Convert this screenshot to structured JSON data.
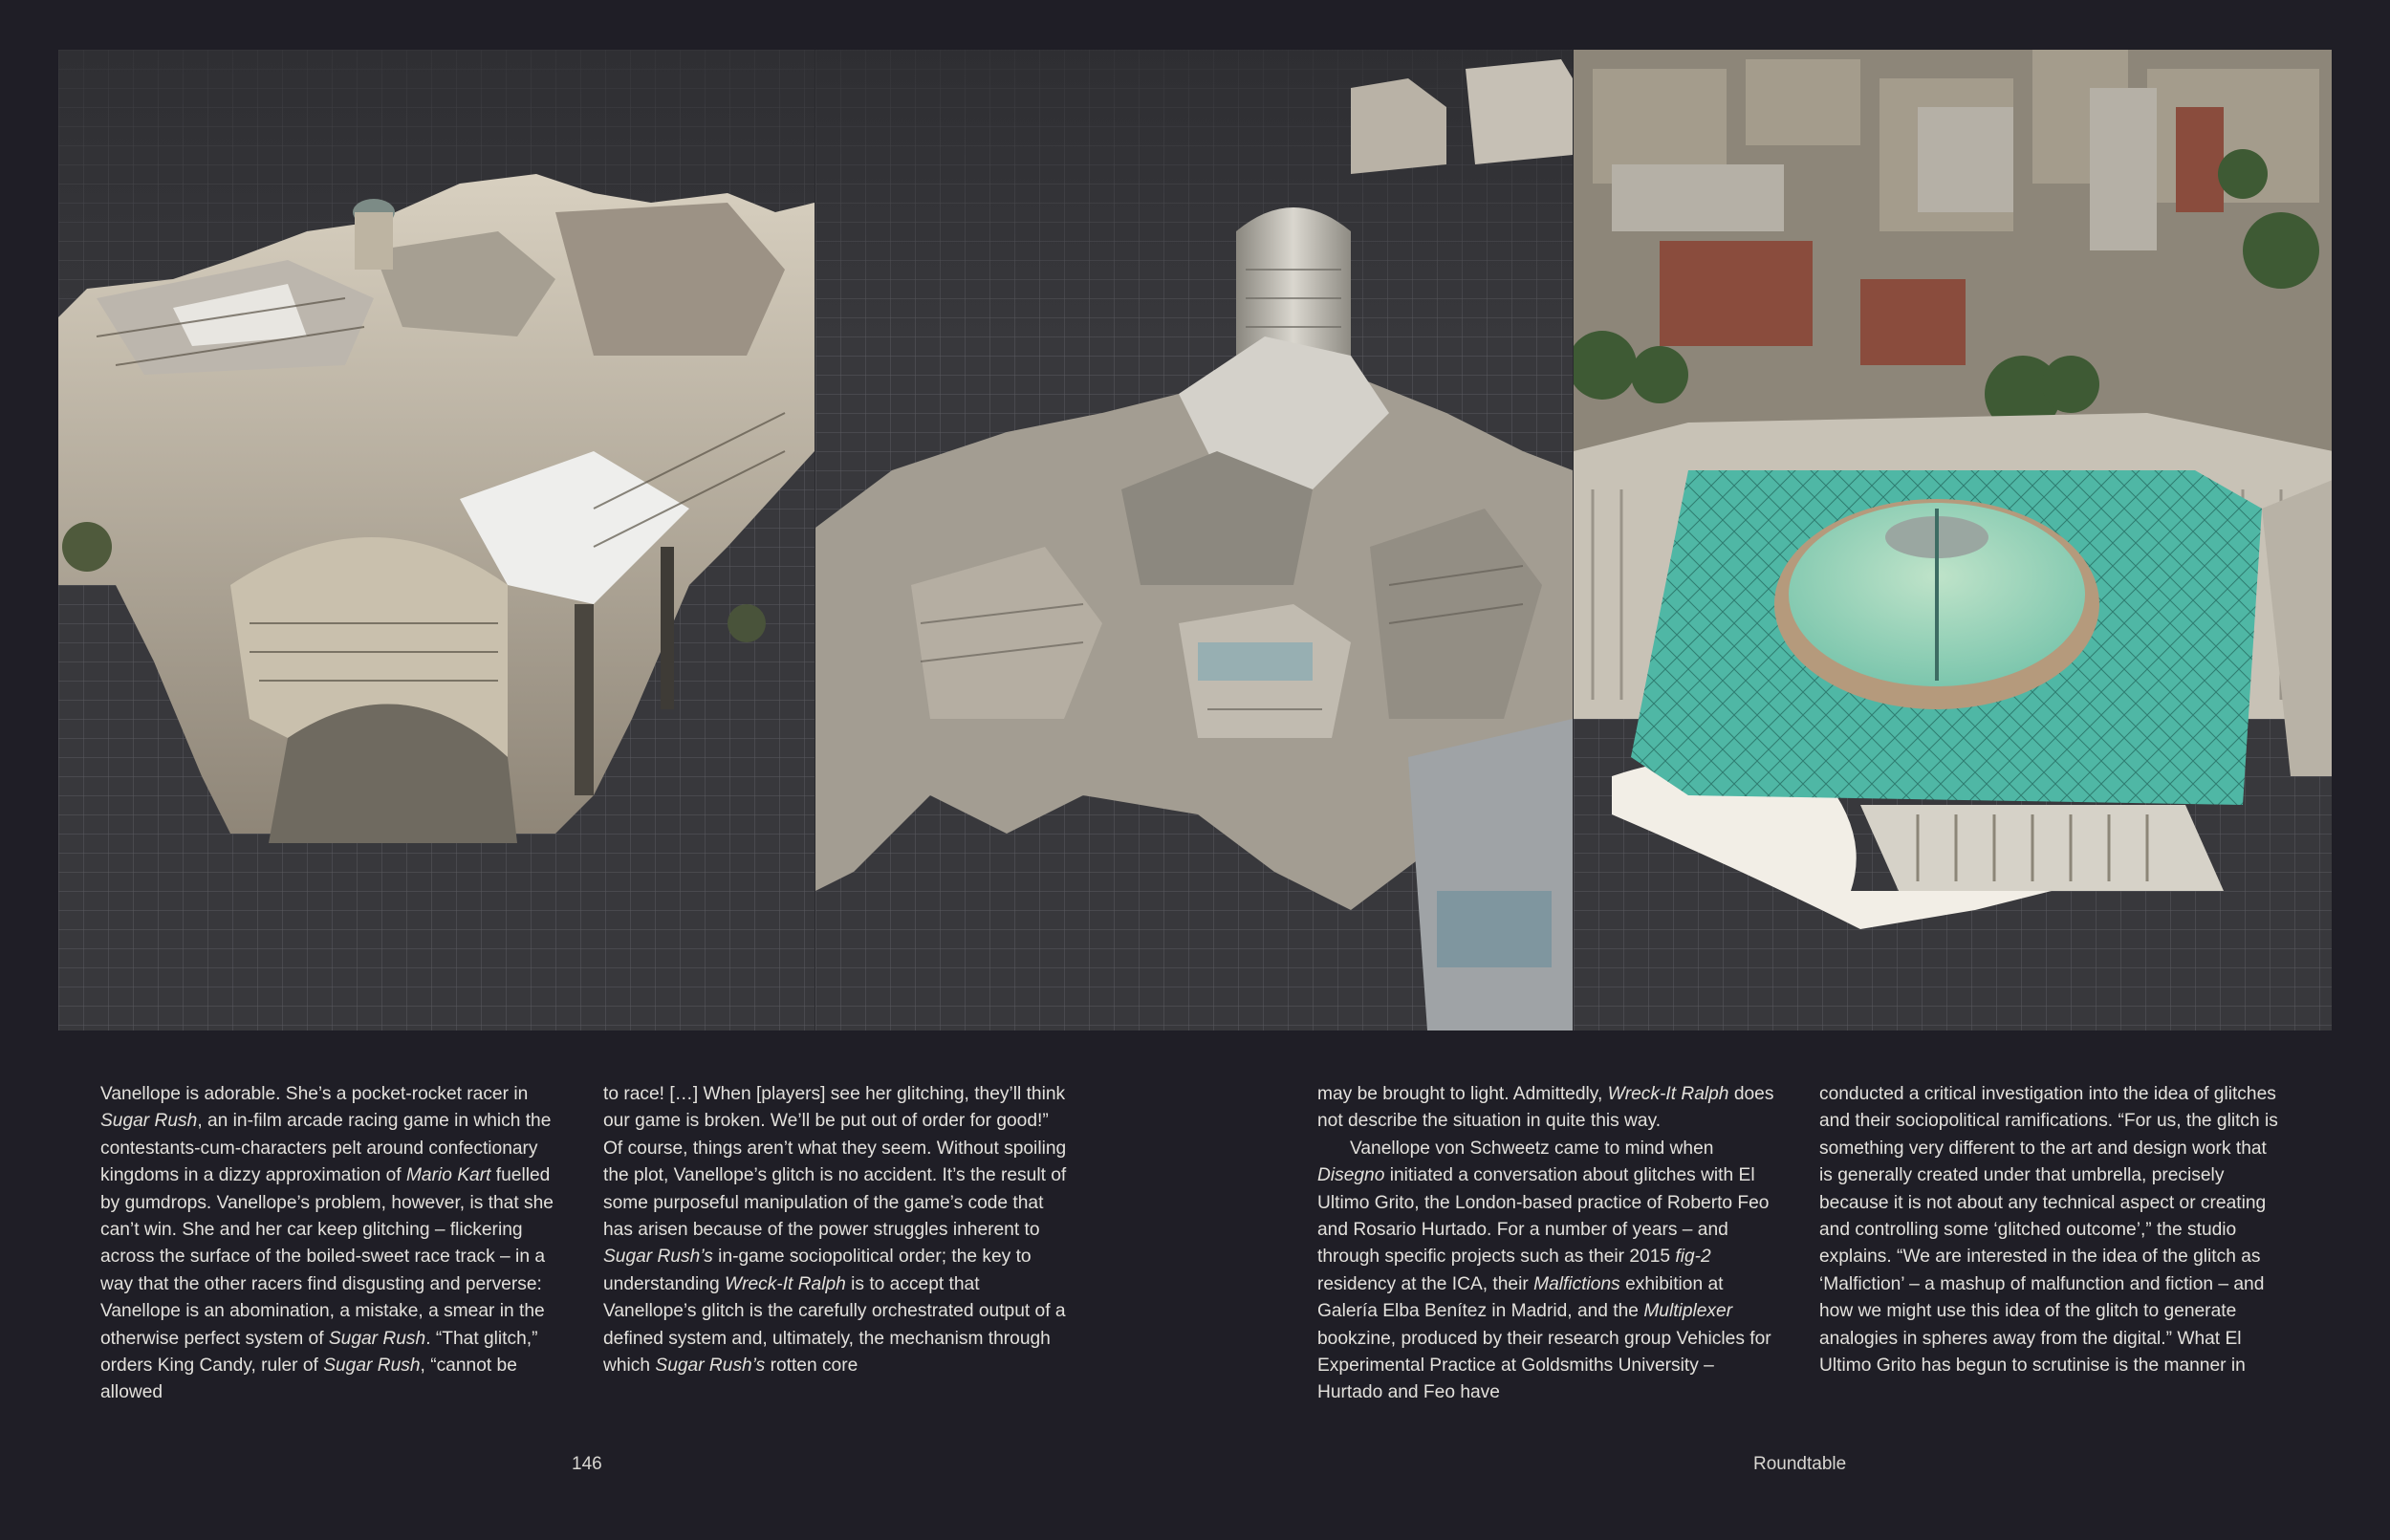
{
  "figure": {
    "panels": [
      {
        "subject": "aerial-3d-city-model-somerset-house"
      },
      {
        "subject": "aerial-3d-city-model-office-towers"
      },
      {
        "subject": "aerial-3d-city-model-british-museum-great-court"
      }
    ],
    "colors": {
      "grid_floor": "#3a3a3e",
      "grid_line": "#5b5b60",
      "glass_roof": "#4fb7a5",
      "stone": "#cfc6b4"
    }
  },
  "columns": {
    "c1": {
      "s1": "Vanellope is adorable. She’s a pocket-rocket racer in ",
      "i1": "Sugar Rush",
      "s2": ", an in-film arcade racing game in which the contestants-cum-characters pelt around confectionary kingdoms in a dizzy approximation of ",
      "i2": "Mario Kart",
      "s3": " fuelled by gumdrops. Vanellope’s problem, however, is that she can’t win. She and her car keep glitching – flickering across the surface of the boiled-sweet race track – in a way that the other racers find disgusting and perverse: Vanellope is an abomination, a mistake, a smear in the otherwise perfect system of ",
      "i3": "Sugar Rush",
      "s4": ". “That glitch,” orders King Candy, ruler of ",
      "i4": "Sugar Rush",
      "s5": ", “cannot be allowed"
    },
    "c2": {
      "s1": "to race! […] When [players] see her glitching, they’ll think our game is broken. We’ll be put out of order for good!” Of course, things aren’t what they seem. Without spoiling the plot, Vanellope’s glitch is no accident. It’s the result of some purposeful manipulation of the game’s code that has arisen because of the power struggles inherent to ",
      "i1": "Sugar Rush’s",
      "s2": " in-game sociopolitical order; the key to understanding ",
      "i2": "Wreck-It Ralph",
      "s3": " is to accept that Vanellope’s glitch is the carefully orchestrated output of a defined system and, ultimately, the mechanism through which ",
      "i3": "Sugar Rush’s",
      "s4": " rotten core"
    },
    "c3": {
      "s1": "may be brought to light. Admittedly, ",
      "i1": "Wreck-It Ralph",
      "s2": " does not describe the situation in quite this way.",
      "p2s1": "Vanellope von Schweetz came to mind when ",
      "p2i1": "Disegno",
      "p2s2": " initiated a conversation about glitches with El Ultimo Grito, the London-based practice of Roberto Feo and Rosario Hurtado. For a number of years – and through specific projects such as their 2015 ",
      "p2i2": "fig-2",
      "p2s3": " residency at the ICA, their ",
      "p2i3": "Malfictions",
      "p2s4": " exhibition at Galería Elba Benítez in Madrid, and the ",
      "p2i4": "Multiplexer",
      "p2s5": " bookzine, produced by their research group Vehicles for Experimental Practice at Goldsmiths University – Hurtado and Feo have"
    },
    "c4": {
      "s1": "conducted a critical investigation into the idea of glitches and their sociopolitical ramifications. “For us, the glitch is something very different to the art and design work that is generally created under that umbrella, precisely because it is not about any technical aspect or creating and controlling some ‘glitched outcome’,” the studio explains. “We are interested in the idea of the glitch as ‘Malfiction’ – a mashup of malfunction and fiction – and how we might use this idea of the glitch to generate analogies in spheres away from the digital.” What El Ultimo Grito has begun to scrutinise is the manner in"
    }
  },
  "footer": {
    "page_number": "146",
    "section": "Roundtable"
  }
}
